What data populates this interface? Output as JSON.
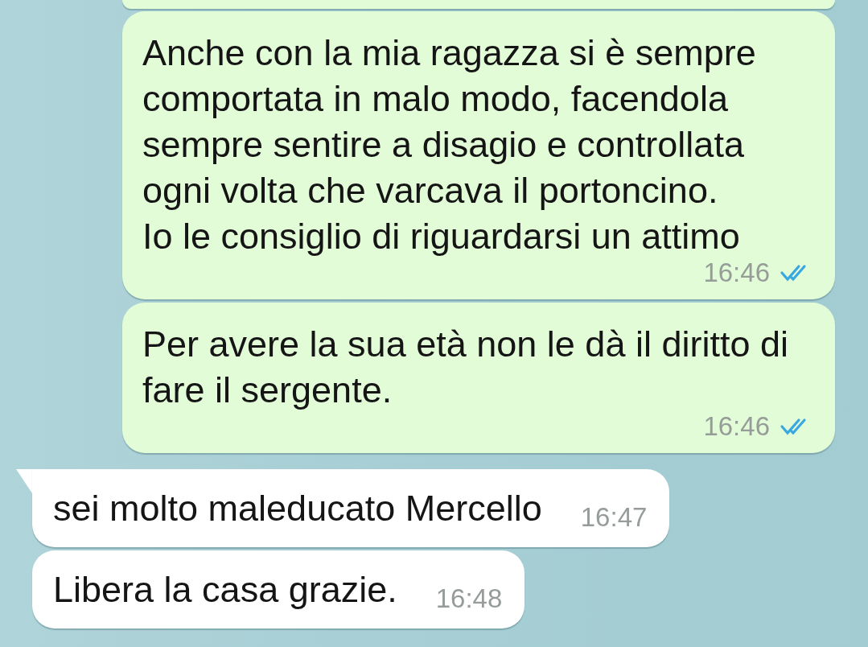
{
  "messages": [
    {
      "kind": "outgoing"
    },
    {
      "kind": "outgoing",
      "text": "Anche con la mia ragazza si è sempre comportata in malo modo, facendola sempre sentire a disagio e controllata ogni volta che varcava il portoncino.\nIo le consiglio di riguardarsi un attimo",
      "time": "16:46",
      "read": true
    },
    {
      "kind": "outgoing",
      "text": "Per avere la sua età non le dà il diritto di fare il sergente.",
      "time": "16:46",
      "read": true
    },
    {
      "kind": "incoming",
      "text": "sei molto maleducato Mercello",
      "time": "16:47",
      "tail": true
    },
    {
      "kind": "incoming",
      "text": "Libera la casa grazie.",
      "time": "16:48",
      "tail": false
    }
  ]
}
